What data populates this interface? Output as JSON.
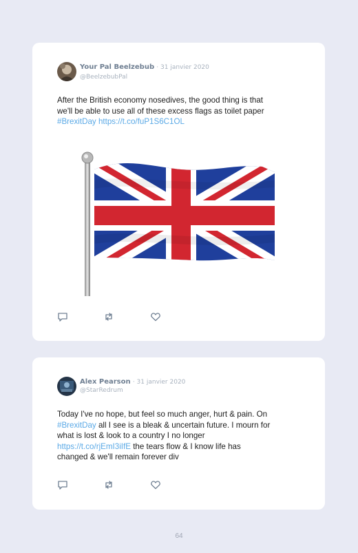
{
  "tweets": [
    {
      "author": "Your Pal Beelzebub",
      "date": "· 31 janvier 2020",
      "handle": "@BeelzebubPal",
      "text_line1": "After the British economy nosedives, the good thing is that",
      "text_line2": "we'll be able to use all of these excess flags as toilet paper",
      "hashtag": "#BrexitDay",
      "link": "https://t.co/fuP1S6C1OL",
      "media": "union-jack-flag-on-pole"
    },
    {
      "author": "Alex Pearson",
      "date": "· 31 janvier 2020",
      "handle": "@StarRedrum",
      "line1": "Today I've no hope, but feel so much anger, hurt & pain. On",
      "hashtag": "#BrexitDay",
      "line2_rest": "all I see is a bleak & uncertain future. I mourn for",
      "line3": "what is lost & look to a country I no longer",
      "link": "https://t.co/rjEmI3iIfE",
      "line4_rest": "the tears flow & I know life has",
      "line5": "changed & we'll remain forever div"
    }
  ],
  "actions": [
    "reply-icon",
    "retweet-icon",
    "like-icon"
  ],
  "page_number": "64",
  "colors": {
    "background": "#e8eaf4",
    "card": "#ffffff",
    "link": "#5aa9e6",
    "author": "#6f7f92",
    "meta": "#a8b2be"
  }
}
